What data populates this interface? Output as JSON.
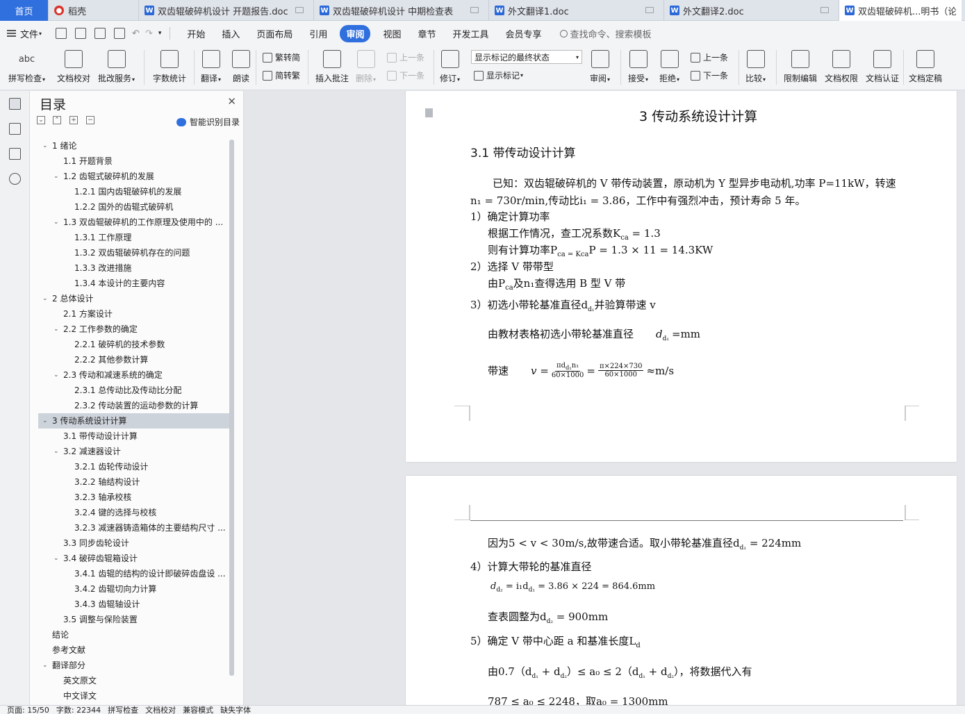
{
  "tabs": [
    {
      "label": "首页",
      "kind": "home"
    },
    {
      "label": "稻壳",
      "kind": "daoke"
    },
    {
      "label": "双齿辊破碎机设计 开题报告.doc",
      "kind": "doc"
    },
    {
      "label": "双齿辊破碎机设计 中期检查表",
      "kind": "doc"
    },
    {
      "label": "外文翻译1.doc",
      "kind": "doc"
    },
    {
      "label": "外文翻译2.doc",
      "kind": "doc"
    },
    {
      "label": "双齿辊破碎机...明书（论文",
      "kind": "active"
    }
  ],
  "menu": {
    "file": "文件",
    "items": [
      "开始",
      "插入",
      "页面布局",
      "引用",
      "审阅",
      "视图",
      "章节",
      "开发工具",
      "会员专享"
    ],
    "active": "审阅",
    "search": "查找命令、搜索模板"
  },
  "ribbon": {
    "spell_check": "拼写检查",
    "doc_proof": "文档校对",
    "batch_service": "批改服务",
    "word_count": "字数统计",
    "translate": "翻译",
    "read_aloud": "朗读",
    "trad_convert": "繁转简",
    "simp_convert": "简转繁",
    "insert_comment": "插入批注",
    "delete": "删除",
    "prev_comment": "上一条",
    "next_comment": "下一条",
    "revise": "修订",
    "markup_select": "显示标记的最终状态",
    "show_markup": "显示标记",
    "review": "审阅",
    "accept": "接受",
    "reject": "拒绝",
    "prev_change": "上一条",
    "next_change": "下一条",
    "compare": "比较",
    "restrict_edit": "限制编辑",
    "doc_permission": "文档权限",
    "doc_auth": "文档认证",
    "doc_finalize": "文档定稿",
    "abc_label": "abc"
  },
  "toc": {
    "title": "目录",
    "smart_label": "智能识别目录",
    "items": [
      {
        "text": "1  绪论",
        "level": 1,
        "caret": true,
        "selected": false
      },
      {
        "text": "1.1 开题背景",
        "level": 2,
        "caret": false,
        "selected": false
      },
      {
        "text": "1.2 齿辊式破碎机的发展",
        "level": 2,
        "caret": true,
        "selected": false
      },
      {
        "text": "1.2.1 国内齿辊破碎机的发展",
        "level": 3,
        "caret": false,
        "selected": false
      },
      {
        "text": "1.2.2 国外的齿辊式破碎机",
        "level": 3,
        "caret": false,
        "selected": false
      },
      {
        "text": "1.3 双齿辊破碎机的工作原理及使用中的 ...",
        "level": 2,
        "caret": true,
        "selected": false
      },
      {
        "text": "1.3.1 工作原理",
        "level": 3,
        "caret": false,
        "selected": false
      },
      {
        "text": "1.3.2 双齿辊破碎机存在的问题",
        "level": 3,
        "caret": false,
        "selected": false
      },
      {
        "text": "1.3.3 改进措施",
        "level": 3,
        "caret": false,
        "selected": false
      },
      {
        "text": "1.3.4 本设计的主要内容",
        "level": 3,
        "caret": false,
        "selected": false
      },
      {
        "text": "2  总体设计",
        "level": 1,
        "caret": true,
        "selected": false
      },
      {
        "text": "2.1 方案设计",
        "level": 2,
        "caret": false,
        "selected": false
      },
      {
        "text": "2.2 工作参数的确定",
        "level": 2,
        "caret": true,
        "selected": false
      },
      {
        "text": "2.2.1 破碎机的技术参数",
        "level": 3,
        "caret": false,
        "selected": false
      },
      {
        "text": "2.2.2 其他参数计算",
        "level": 3,
        "caret": false,
        "selected": false
      },
      {
        "text": "2.3 传动和减速系统的确定",
        "level": 2,
        "caret": true,
        "selected": false
      },
      {
        "text": "2.3.1 总传动比及传动比分配",
        "level": 3,
        "caret": false,
        "selected": false
      },
      {
        "text": "2.3.2 传动装置的运动参数的计算",
        "level": 3,
        "caret": false,
        "selected": false
      },
      {
        "text": "3  传动系统设计计算",
        "level": 1,
        "caret": true,
        "selected": true
      },
      {
        "text": "3.1  带传动设计计算",
        "level": 2,
        "caret": false,
        "selected": false
      },
      {
        "text": "3.2 减速器设计",
        "level": 2,
        "caret": true,
        "selected": false
      },
      {
        "text": "3.2.1 齿轮传动设计",
        "level": 3,
        "caret": false,
        "selected": false
      },
      {
        "text": "3.2.2 轴结构设计",
        "level": 3,
        "caret": false,
        "selected": false
      },
      {
        "text": "3.2.3 轴承校核",
        "level": 3,
        "caret": false,
        "selected": false
      },
      {
        "text": "3.2.4 键的选择与校核",
        "level": 3,
        "caret": false,
        "selected": false
      },
      {
        "text": "3.2.3 减速器铸造箱体的主要结构尺寸 ...",
        "level": 3,
        "caret": false,
        "selected": false
      },
      {
        "text": "3.3 同步齿轮设计",
        "level": 2,
        "caret": false,
        "selected": false
      },
      {
        "text": "3.4 破碎齿辊箱设计",
        "level": 2,
        "caret": true,
        "selected": false
      },
      {
        "text": "3.4.1 齿辊的结构的设计即破碎齿盘设 ...",
        "level": 3,
        "caret": false,
        "selected": false
      },
      {
        "text": "3.4.2 齿辊切向力计算",
        "level": 3,
        "caret": false,
        "selected": false
      },
      {
        "text": "3.4.3 齿辊轴设计",
        "level": 3,
        "caret": false,
        "selected": false
      },
      {
        "text": "3.5 调整与保险装置",
        "level": 2,
        "caret": false,
        "selected": false
      },
      {
        "text": "结论",
        "level": 1,
        "caret": false,
        "selected": false
      },
      {
        "text": "参考文献",
        "level": 1,
        "caret": false,
        "selected": false
      },
      {
        "text": "翻译部分",
        "level": 1,
        "caret": true,
        "selected": false
      },
      {
        "text": "英文原文",
        "level": 2,
        "caret": false,
        "selected": false
      },
      {
        "text": "中文译文",
        "level": 2,
        "caret": false,
        "selected": false
      }
    ]
  },
  "page1": {
    "heading": "3  传动系统设计计算",
    "section": "3.1  带传动设计计算",
    "para1_a": "已知：双齿辊破碎机的 V 带传动装置，原动机为 Y 型异步电动机,功率 P=11kW，转速",
    "para1_b": "n₁ = 730r/min,传动比i₁ = 3.86，工作中有强烈冲击，预计寿命 5 年。",
    "step1": "1）确定计算功率",
    "step1_a": "根据工作情况，查工况系数K",
    "step1_a_sub": "ca",
    "step1_a_val": " = 1.3",
    "step1_b": "则有计算功率P",
    "step1_b_rest": "ca = K",
    "step1_b_rest2": "ca",
    "step1_b_eq": "P = 1.3 × 11 = 14.3KW",
    "step2": "2）选择 V 带带型",
    "step2_a": "由P",
    "step2_a_sub": "ca",
    "step2_a_rest": "及n₁查得选用 B 型 V 带",
    "step3": "3）初选小带轮基准直径d",
    "step3_sub": "d₁",
    "step3_rest": "并验算带速 v",
    "step3_a": "由教材表格初选小带轮基准直径",
    "step3_a_var": "d",
    "step3_a_sub": "d₁",
    "step3_a_unit": "=mm",
    "speed_label": "带速",
    "speed_eq_v": "v =",
    "speed_num1": "πd",
    "speed_num1_sub": "d₁",
    "speed_num1_rest": "n₁",
    "speed_den1": "60×1000",
    "speed_eq": "=",
    "speed_num2": "π×224×730",
    "speed_den2": "60×1000",
    "speed_tail": "≈m/s"
  },
  "page2": {
    "line1_a": "因为5 < v < 30m/s,故带速合适。取小带轮基准直径d",
    "line1_sub": "d₁",
    "line1_b": " = 224mm",
    "step4": "4）计算大带轮的基准直径",
    "step4_a": "d",
    "step4_a_sub": "d₂",
    "step4_a_mid": " = i₁d",
    "step4_a_sub2": "d₁",
    "step4_a_rest": " = 3.86 × 224 = 864.6mm",
    "step4_b": "查表圆整为d",
    "step4_b_sub": "d₂",
    "step4_b_rest": " = 900mm",
    "step5": "5）确定 V 带中心距 a 和基准长度L",
    "step5_sub": "d",
    "step5_a": "由0.7（d",
    "step5_a_s1": "d₁",
    "step5_a_m1": " + d",
    "step5_a_s2": "d₂",
    "step5_a_m2": "）≤ a₀ ≤ 2（d",
    "step5_a_s3": "d₁",
    "step5_a_m3": " + d",
    "step5_a_s4": "d₂",
    "step5_a_end": "），将数据代入有",
    "step5_b": "787 ≤ a₀ ≤ 2248，取a₀ = 1300mm"
  },
  "status": {
    "page": "页面: 15/50",
    "words": "字数: 22344",
    "spell": "拼写检查",
    "proof": "文档校对",
    "compat": "兼容模式",
    "font": "缺失字体"
  },
  "colors": {
    "accent": "#2f6fde",
    "selected_toc": "#cdd3db"
  }
}
